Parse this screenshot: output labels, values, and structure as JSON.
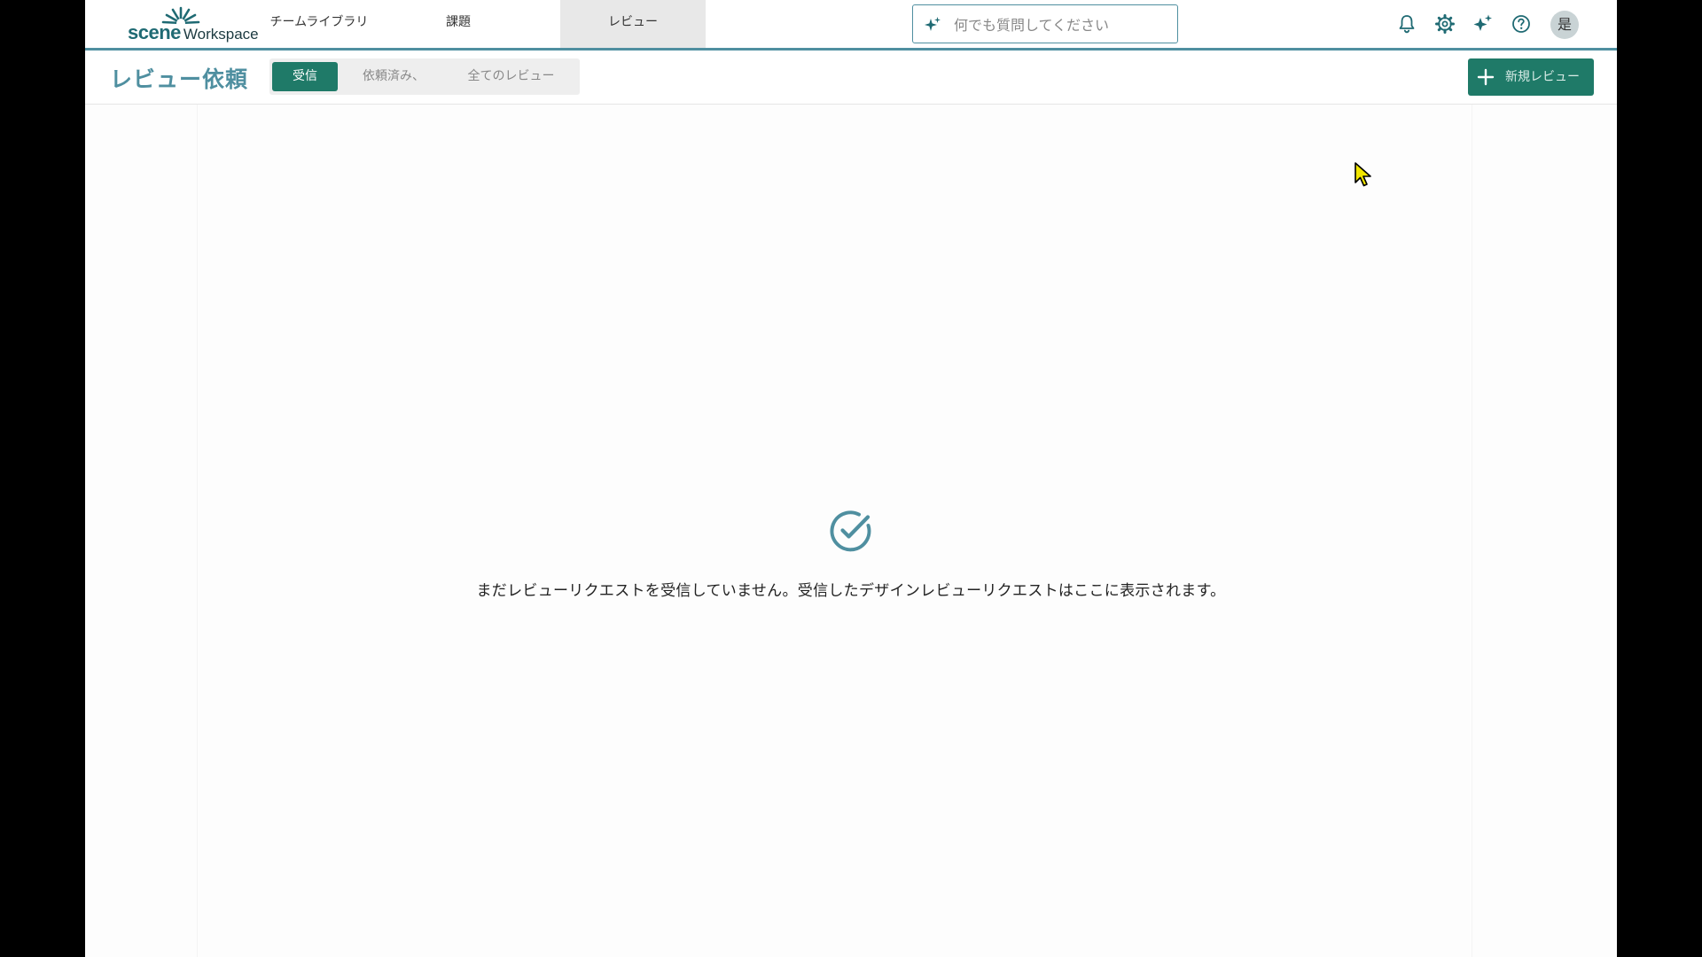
{
  "app": {
    "logo_primary": "scene",
    "logo_secondary": "Workspace"
  },
  "nav": {
    "tabs": [
      {
        "label": "チームライブラリ"
      },
      {
        "label": "課題"
      },
      {
        "label": "レビュー",
        "active": true
      }
    ]
  },
  "search": {
    "placeholder": "何でも質問してください",
    "icon": "sparkle-icon"
  },
  "toolbar_icons": [
    "bell-icon",
    "gear-icon",
    "sparkle-icon",
    "help-icon"
  ],
  "user": {
    "avatar_text": "是"
  },
  "page": {
    "title": "レビュー依頼",
    "segments": [
      {
        "label": "受信",
        "active": true
      },
      {
        "label": "依頼済み、"
      },
      {
        "label": "全てのレビュー"
      }
    ],
    "new_button_label": "新規レビュー"
  },
  "empty_state": {
    "icon": "check-circle-icon",
    "message": "まだレビューリクエストを受信していません。受信したデザインレビューリクエストはここに表示されます。"
  },
  "colors": {
    "accent": "#4f8fa0",
    "primary_button": "#1f7a68",
    "logo": "#1f6a73"
  }
}
